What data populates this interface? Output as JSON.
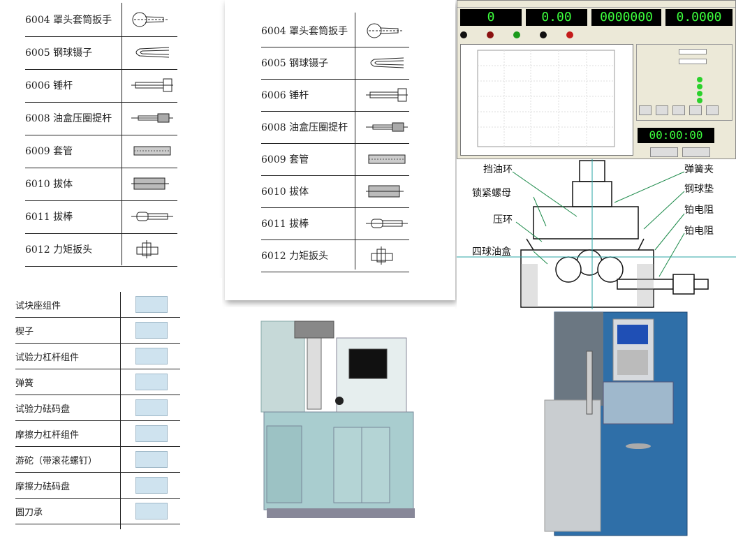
{
  "parts_a": [
    {
      "code": "6004",
      "name": "罩头套筒扳手"
    },
    {
      "code": "6005",
      "name": "钢球镊子"
    },
    {
      "code": "6006",
      "name": "锤杆"
    },
    {
      "code": "6008",
      "name": "油盒压圈提杆"
    },
    {
      "code": "6009",
      "name": "套管"
    },
    {
      "code": "6010",
      "name": "拔体"
    },
    {
      "code": "6011",
      "name": "拔棒"
    },
    {
      "code": "6012",
      "name": "力矩扳头"
    }
  ],
  "parts_b": [
    {
      "code": "6004",
      "name": "罩头套筒扳手"
    },
    {
      "code": "6005",
      "name": "钢球镊子"
    },
    {
      "code": "6006",
      "name": "锤杆"
    },
    {
      "code": "6008",
      "name": "油盒压圈提杆"
    },
    {
      "code": "6009",
      "name": "套管"
    },
    {
      "code": "6010",
      "name": "拔体"
    },
    {
      "code": "6011",
      "name": "拔棒"
    },
    {
      "code": "6012",
      "name": "力矩扳头"
    }
  ],
  "parts_c": [
    "试块座组件",
    "楔子",
    "试验力杠杆组件",
    "弹簧",
    "试验力砝码盘",
    "摩擦力杠杆组件",
    "游砣（带滚花螺钉）",
    "摩擦力砝码盘",
    "圆刀承"
  ],
  "software": {
    "displays": [
      "0",
      "0.00",
      "0000000",
      "0.0000"
    ],
    "timer": "00:00:00"
  },
  "diagram_labels": {
    "l1": "挡油环",
    "l2": "锁紧螺母",
    "l3": "压环",
    "l4": "四球油盒",
    "r1": "弹簧夹",
    "r2": "钢球垫",
    "r3": "铂电阻",
    "r4": "铂电阻"
  },
  "colors": {
    "accent": "#3dff3d",
    "machine_body": "#a9cdcf",
    "machine_blue": "#2f6fa8"
  }
}
